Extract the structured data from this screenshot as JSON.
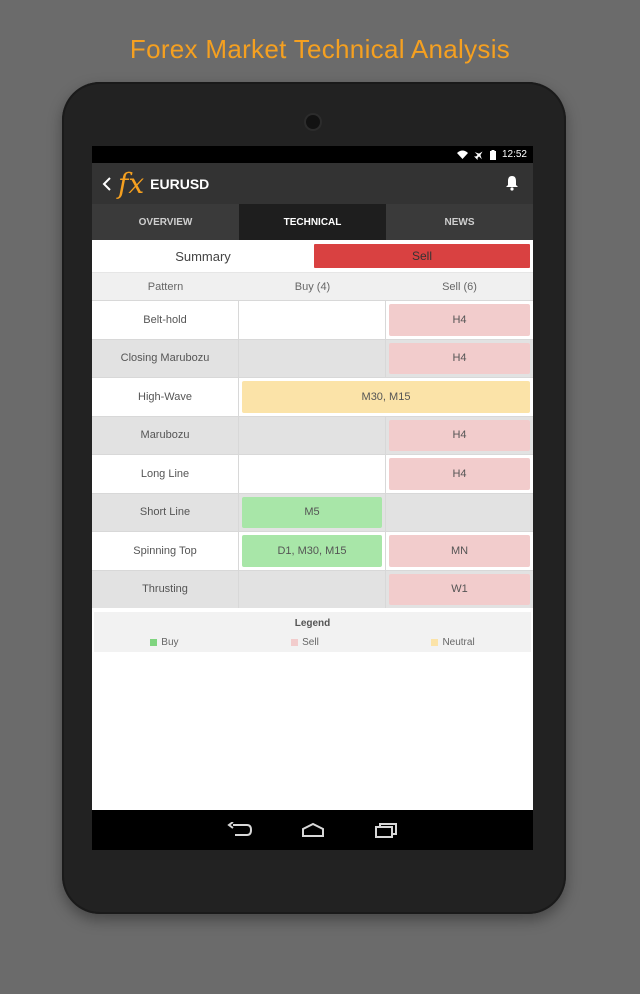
{
  "promo": {
    "title": "Forex Market Technical Analysis"
  },
  "status_bar": {
    "time": "12:52",
    "icons": [
      "wifi-icon",
      "airplane-icon",
      "battery-icon"
    ]
  },
  "action_bar": {
    "logo": "fx",
    "title": "EURUSD",
    "back_icon": "back-chevron-icon",
    "bell_icon": "bell-icon"
  },
  "tabs": [
    {
      "label": "OVERVIEW",
      "active": false
    },
    {
      "label": "TECHNICAL",
      "active": true
    },
    {
      "label": "NEWS",
      "active": false
    }
  ],
  "summary": {
    "label": "Summary",
    "value": "Sell"
  },
  "grid": {
    "headers": [
      "Pattern",
      "Buy (4)",
      "Sell (6)"
    ],
    "rows": [
      {
        "pattern": "Belt-hold",
        "buy": "",
        "sell": "H4"
      },
      {
        "pattern": "Closing Marubozu",
        "buy": "",
        "sell": "H4"
      },
      {
        "pattern": "High-Wave",
        "neutral": "M30, M15"
      },
      {
        "pattern": "Marubozu",
        "buy": "",
        "sell": "H4"
      },
      {
        "pattern": "Long Line",
        "buy": "",
        "sell": "H4"
      },
      {
        "pattern": "Short Line",
        "buy": "M5",
        "sell": ""
      },
      {
        "pattern": "Spinning Top",
        "buy": "D1, M30, M15",
        "sell": "MN"
      },
      {
        "pattern": "Thrusting",
        "buy": "",
        "sell": "W1"
      }
    ]
  },
  "legend": {
    "title": "Legend",
    "items": [
      {
        "label": "Buy",
        "color": "#7fd47f"
      },
      {
        "label": "Sell",
        "color": "#f2cccc"
      },
      {
        "label": "Neutral",
        "color": "#fbe3a8"
      }
    ]
  },
  "colors": {
    "accent": "#f5a020",
    "sell": "#d94141"
  }
}
